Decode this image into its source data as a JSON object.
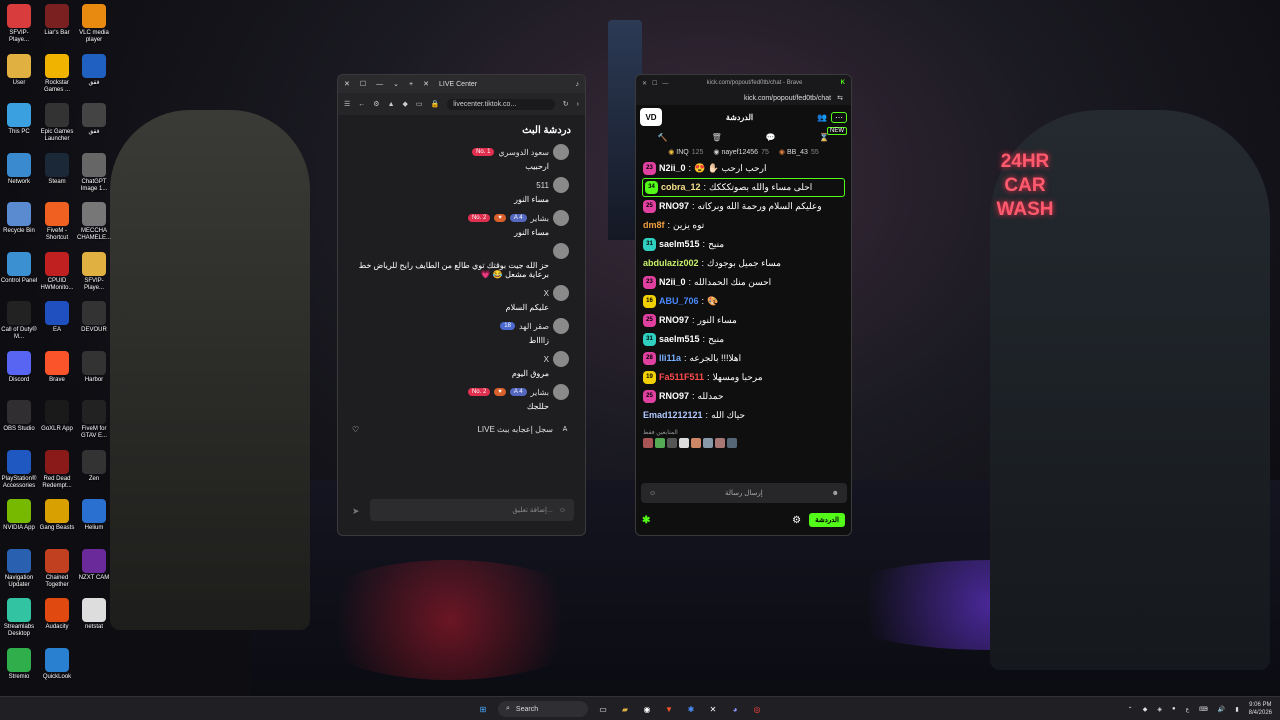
{
  "desktop": {
    "icons": [
      {
        "label": "SFVIP-Playe...",
        "icon": "sfvip-icon",
        "color": "#d83c3c"
      },
      {
        "label": "Liar's Bar",
        "icon": "liars-bar-icon",
        "color": "#7a2020"
      },
      {
        "label": "VLC media player",
        "icon": "vlc-icon",
        "color": "#e88a10"
      },
      {
        "label": "User",
        "icon": "folder-icon",
        "color": "#e0b040"
      },
      {
        "label": "Rockstar Games ...",
        "icon": "rockstar-icon",
        "color": "#f0b400"
      },
      {
        "label": "ققق",
        "icon": "app-icon",
        "color": "#2060c0"
      },
      {
        "label": "This PC",
        "icon": "pc-icon",
        "color": "#3aa0e0"
      },
      {
        "label": "Epic Games Launcher",
        "icon": "epic-icon",
        "color": "#333"
      },
      {
        "label": "ققق",
        "icon": "media-icon",
        "color": "#444"
      },
      {
        "label": "Network",
        "icon": "network-icon",
        "color": "#3a8ad0"
      },
      {
        "label": "Steam",
        "icon": "steam-icon",
        "color": "#1b2838"
      },
      {
        "label": "ChatGPT Image 1...",
        "icon": "image-icon",
        "color": "#666"
      },
      {
        "label": "Recycle Bin",
        "icon": "recycle-bin-icon",
        "color": "#5a8ad0"
      },
      {
        "label": "FiveM - Shortcut",
        "icon": "fivem-icon",
        "color": "#f06020"
      },
      {
        "label": "MECCHA CHAMELE...",
        "icon": "image-icon",
        "color": "#777"
      },
      {
        "label": "Control Panel",
        "icon": "control-panel-icon",
        "color": "#3a90d0"
      },
      {
        "label": "CPUID HWMonito...",
        "icon": "hwmonitor-icon",
        "color": "#c02020"
      },
      {
        "label": "SFVIP-Playe...",
        "icon": "folder-icon",
        "color": "#e0b040"
      },
      {
        "label": "Call of Duty® M...",
        "icon": "cod-icon",
        "color": "#222"
      },
      {
        "label": "EA",
        "icon": "ea-icon",
        "color": "#2050c0"
      },
      {
        "label": "DEVOUR",
        "icon": "devour-icon",
        "color": "#333"
      },
      {
        "label": "Discord",
        "icon": "discord-icon",
        "color": "#5865f2"
      },
      {
        "label": "Brave",
        "icon": "brave-icon",
        "color": "#fb542b"
      },
      {
        "label": "Harbor",
        "icon": "harbor-icon",
        "color": "#333"
      },
      {
        "label": "OBS Studio",
        "icon": "obs-icon",
        "color": "#302e31"
      },
      {
        "label": "GoXLR App",
        "icon": "goxlr-icon",
        "color": "#1a1a1a"
      },
      {
        "label": "FiveM for GTAV E...",
        "icon": "fivem-icon",
        "color": "#222"
      },
      {
        "label": "PlayStation® Accessories",
        "icon": "playstation-icon",
        "color": "#1f58c0"
      },
      {
        "label": "Red Dead Redempt...",
        "icon": "rdr-icon",
        "color": "#8a1a1a"
      },
      {
        "label": "Zen",
        "icon": "zen-icon",
        "color": "#333"
      },
      {
        "label": "NVIDIA App",
        "icon": "nvidia-icon",
        "color": "#76b900"
      },
      {
        "label": "Gang Beasts",
        "icon": "gang-beasts-icon",
        "color": "#d8a000"
      },
      {
        "label": "Helium",
        "icon": "helium-icon",
        "color": "#2a70d0"
      },
      {
        "label": "Navigation Updater",
        "icon": "navigation-icon",
        "color": "#2a60b0"
      },
      {
        "label": "Chained Together",
        "icon": "chained-icon",
        "color": "#c04020"
      },
      {
        "label": "NZXT CAM",
        "icon": "nzxt-icon",
        "color": "#6a2a9a"
      },
      {
        "label": "Streamlabs Desktop",
        "icon": "streamlabs-icon",
        "color": "#31c3a2"
      },
      {
        "label": "Audacity",
        "icon": "audacity-icon",
        "color": "#e04a10"
      },
      {
        "label": "netstat",
        "icon": "file-icon",
        "color": "#ddd"
      },
      {
        "label": "Stremio",
        "icon": "stremio-icon",
        "color": "#2fae4b"
      },
      {
        "label": "QuickLook",
        "icon": "quicklook-icon",
        "color": "#2a80d0"
      }
    ]
  },
  "wallpaper": {
    "neon_sign": [
      "24HR",
      "CAR",
      "WASH"
    ]
  },
  "tiktok": {
    "tab_title": "LIVE Center",
    "url": "livecenter.tiktok.co...",
    "heading": "دردشة البث",
    "messages": [
      {
        "name": "سعود الدوسري",
        "badges": [
          {
            "text": "No. 1",
            "cls": "b-red"
          }
        ],
        "text": "ارحبيب"
      },
      {
        "name": "511",
        "badges": [],
        "text": "مساء النور"
      },
      {
        "name": "بشاير",
        "badges": [
          {
            "text": "A 4",
            "cls": "b-blue"
          },
          {
            "text": "♥",
            "cls": "b-orange"
          },
          {
            "text": "No. 2",
            "cls": "b-red"
          }
        ],
        "text": "مساء النور"
      },
      {
        "name": "",
        "badges": [],
        "text": "حز الله جيت بوقتك توي طالع من الطايف رايح للرياض خط برعاية مشعل 😂 💗"
      },
      {
        "name": "X",
        "badges": [],
        "text": "عليكم السلام"
      },
      {
        "name": "صقر الهد",
        "badges": [
          {
            "text": "18",
            "cls": "b-lblue"
          }
        ],
        "text": "زااااط"
      },
      {
        "name": "X",
        "badges": [],
        "text": "مروق اليوم"
      },
      {
        "name": "بشاير",
        "badges": [
          {
            "text": "A 4",
            "cls": "b-blue"
          },
          {
            "text": "♥",
            "cls": "b-orange"
          },
          {
            "text": "No. 2",
            "cls": "b-red"
          }
        ],
        "text": "حللجك"
      }
    ],
    "live_record": "سجل إعجابه ببث LIVE",
    "live_record_initial": "A",
    "comment_placeholder": "إضافة تعليق..."
  },
  "kick": {
    "window_url": "kick.com/popout/fed0tb/chat - Brave",
    "address": "kick.com/popout/fed0tb/chat",
    "header_title": "الدردشة",
    "new_label": "NEW",
    "top": [
      {
        "name": "INQ",
        "count": "125"
      },
      {
        "name": "nayef12456",
        "count": "75"
      },
      {
        "name": "BB_43",
        "count": "55"
      }
    ],
    "messages": [
      {
        "lvl": "23",
        "lcolor": "#e040a0",
        "user": "N2ii_0",
        "ucolor": "#ffffff",
        "text": "ارحب ارحب ✋🏻 😍",
        "hl": false
      },
      {
        "lvl": "34",
        "lcolor": "#53fc18",
        "user": "cobra_12",
        "ucolor": "#f5e08a",
        "text": "احلى مساء والله بصوتكككك",
        "hl": true
      },
      {
        "lvl": "25",
        "lcolor": "#e040a0",
        "user": "RNO97",
        "ucolor": "#ffffff",
        "text": "وعليكم السلام ورحمة الله وبركاته",
        "hl": false
      },
      {
        "lvl": "",
        "lcolor": "",
        "user": "dm8f",
        "ucolor": "#f0a040",
        "text": "توه يزين",
        "hl": false
      },
      {
        "lvl": "31",
        "lcolor": "#2fd0c0",
        "user": "saelm515",
        "ucolor": "#ffffff",
        "text": "منيح",
        "hl": false
      },
      {
        "lvl": "",
        "lcolor": "",
        "user": "abdulaziz002",
        "ucolor": "#c8f06a",
        "text": "مساء جميل بوجودك",
        "hl": false
      },
      {
        "lvl": "23",
        "lcolor": "#e040a0",
        "user": "N2ii_0",
        "ucolor": "#ffffff",
        "text": "احسن منك الحمدالله",
        "hl": false
      },
      {
        "lvl": "16",
        "lcolor": "#f0d000",
        "user": "ABU_706",
        "ucolor": "#4a8aff",
        "text": "🎨",
        "hl": false
      },
      {
        "lvl": "25",
        "lcolor": "#e040a0",
        "user": "RNO97",
        "ucolor": "#ffffff",
        "text": "مساء النور",
        "hl": false
      },
      {
        "lvl": "31",
        "lcolor": "#2fd0c0",
        "user": "saelm515",
        "ucolor": "#ffffff",
        "text": "منيح",
        "hl": false
      },
      {
        "lvl": "28",
        "lcolor": "#e040a0",
        "user": "lli11a",
        "ucolor": "#7ab0ff",
        "text": "اهلا!!! بالجرعه",
        "hl": false
      },
      {
        "lvl": "19",
        "lcolor": "#f0d000",
        "user": "Fa511F511",
        "ucolor": "#ff4a4a",
        "text": "مرحبا ومسهلا",
        "hl": false
      },
      {
        "lvl": "25",
        "lcolor": "#e040a0",
        "user": "RNO97",
        "ucolor": "#ffffff",
        "text": "حمدلله",
        "hl": false
      },
      {
        "lvl": "",
        "lcolor": "",
        "user": "Emad1212121",
        "ucolor": "#b0c8ff",
        "text": "حياك الله",
        "hl": false
      }
    ],
    "viewers_label": "المتابعين فقط",
    "input_placeholder": "إرسال رسالة",
    "chat_button": "الدردشة"
  },
  "taskbar": {
    "search_label": "Search",
    "time": "9:06 PM",
    "date": "8/4/2026",
    "lang": "ع"
  }
}
